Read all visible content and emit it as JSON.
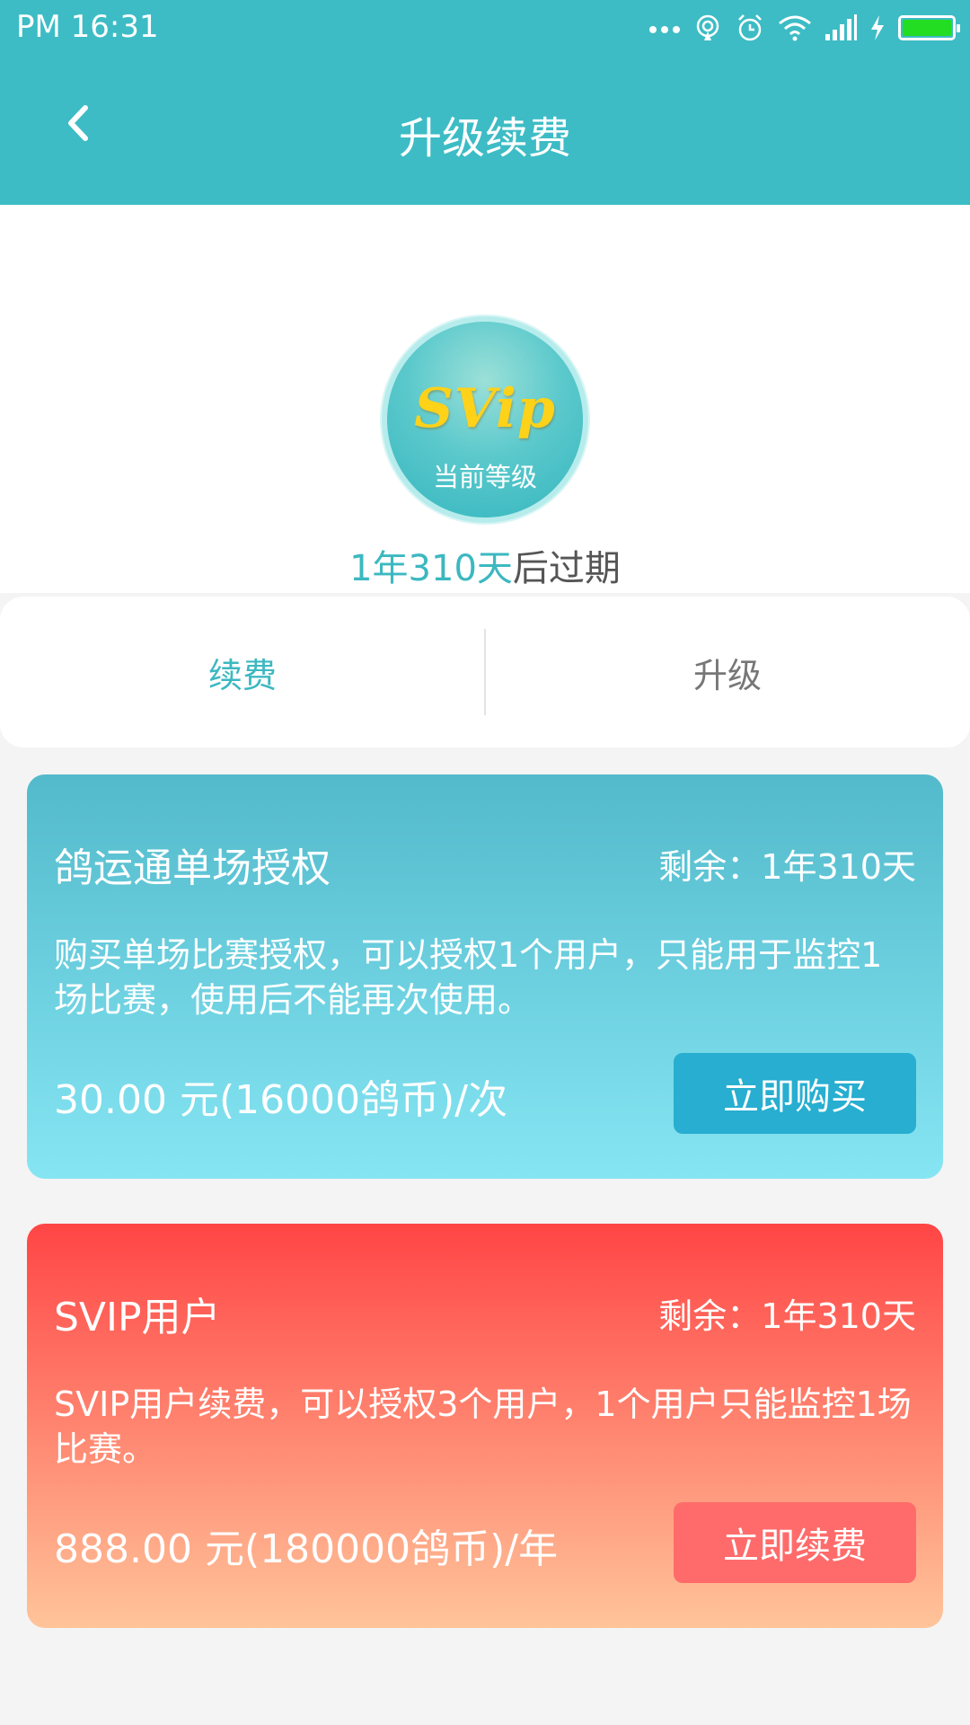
{
  "status_bar": {
    "time": "PM  16:31",
    "dots": "..."
  },
  "header": {
    "title": "升级续费"
  },
  "membership": {
    "logo_text": "SVip",
    "level_label": "当前等级",
    "expire_duration": "1年310天",
    "expire_suffix": "后过期"
  },
  "tabs": [
    {
      "label": "续费",
      "active": true
    },
    {
      "label": "升级",
      "active": false
    }
  ],
  "cards": [
    {
      "title": "鸽运通单场授权",
      "remaining": "剩余：1年310天",
      "description": "购买单场比赛授权，可以授权1个用户，只能用于监控1场比赛，使用后不能再次使用。",
      "price": "30.00 元(16000鸽币)/次",
      "button_label": "立即购买"
    },
    {
      "title": "SVIP用户",
      "remaining": "剩余：1年310天",
      "description": "SVIP用户续费，可以授权3个用户，1个用户只能监控1场比赛。",
      "price": "888.00 元(180000鸽币)/年",
      "button_label": "立即续费"
    }
  ],
  "colors": {
    "primary": "#3dbcc5",
    "accent_text": "#3cb8c0",
    "card1_top": "#52bacb",
    "card1_bottom": "#86e5f3",
    "card1_button": "#27aed0",
    "card2_top": "#ff4545",
    "card2_bottom": "#ffc49a",
    "card2_button": "#ff6b6b"
  },
  "icons": [
    "back-arrow-icon",
    "more-dots-icon",
    "hotspot-icon",
    "alarm-icon",
    "wifi-icon",
    "signal-icon",
    "charging-icon",
    "battery-icon"
  ]
}
